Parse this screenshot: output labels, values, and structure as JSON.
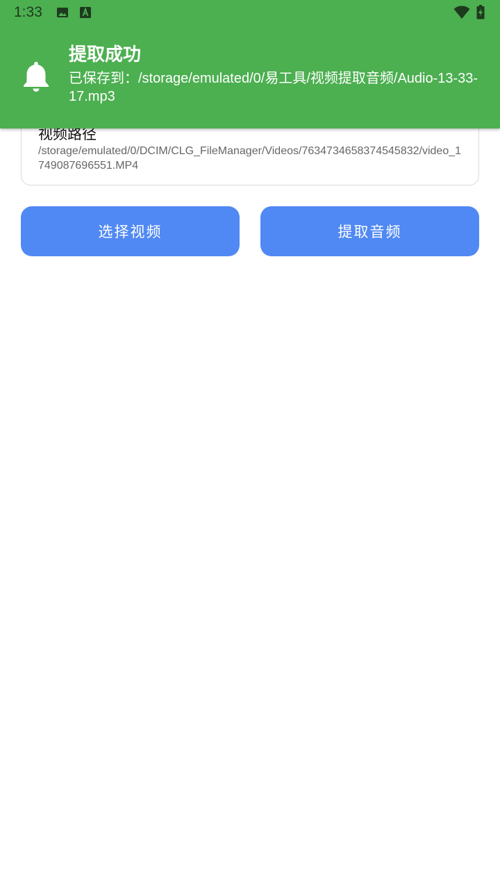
{
  "status_bar": {
    "time": "1:33",
    "icons": [
      "image-icon",
      "font-download-icon",
      "wifi-icon",
      "battery-charging-icon"
    ]
  },
  "notification": {
    "icon": "bell-icon",
    "title": "提取成功",
    "message": "已保存到：/storage/emulated/0/易工具/视频提取音频/Audio-13-33-17.mp3",
    "background_color": "#4caf50"
  },
  "video_path_card": {
    "label": "视频路径",
    "value": "/storage/emulated/0/DCIM/CLG_FileManager/Videos/7634734658374545832/video_1749087696551.MP4"
  },
  "buttons": {
    "select_video": "选择视频",
    "extract_audio": "提取音频",
    "color": "#5089f3"
  }
}
